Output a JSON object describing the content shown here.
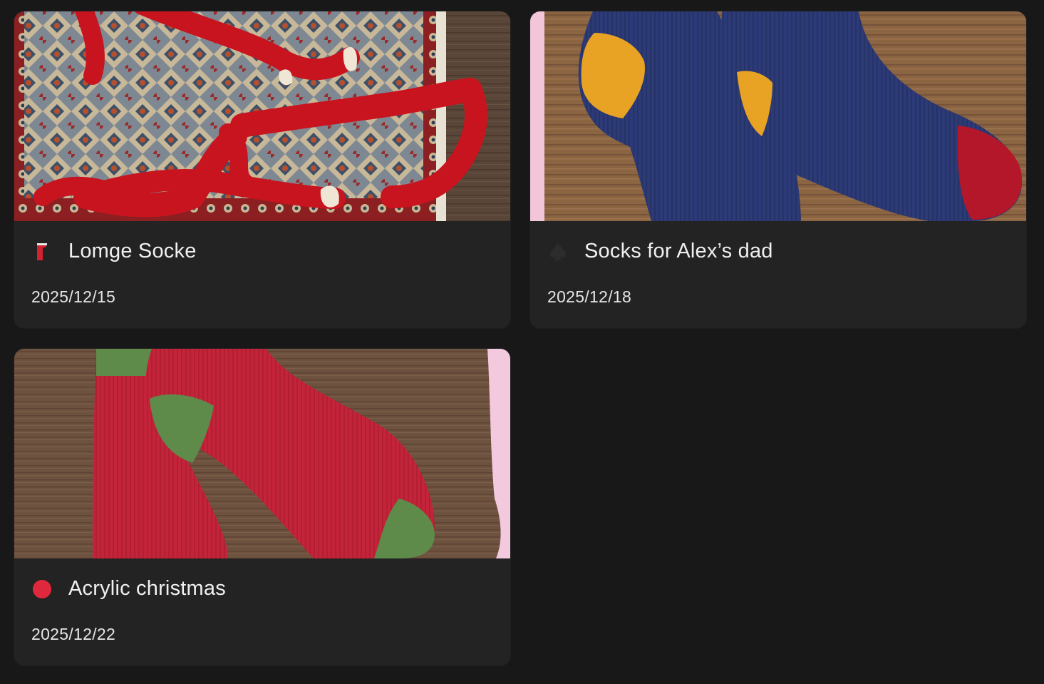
{
  "projects": [
    {
      "title": "Lomge Socke",
      "date": "2025/12/15",
      "icon": "sock-icon",
      "icon_color": "#d1222f",
      "photo": "long-red-socks-on-persian-rug"
    },
    {
      "title": "Socks for Alex’s dad",
      "date": "2025/12/18",
      "icon": "spade-icon",
      "icon_color": "#2c2c2c",
      "photo": "navy-socks-yellow-heel-on-wood"
    },
    {
      "title": "Acrylic christmas",
      "date": "2025/12/22",
      "icon": "red-dot-icon",
      "icon_color": "#e0283d",
      "photo": "red-socks-green-toe-on-wood"
    }
  ]
}
